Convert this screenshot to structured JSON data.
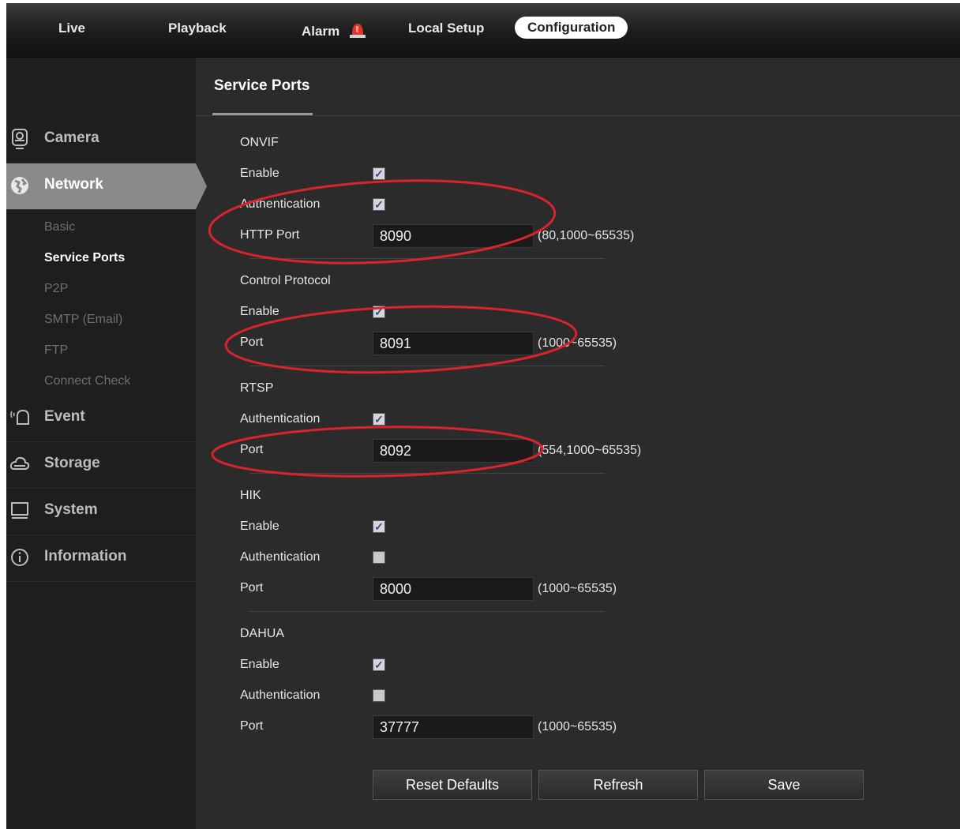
{
  "topnav": {
    "live": "Live",
    "playback": "Playback",
    "alarm": "Alarm",
    "local_setup": "Local Setup",
    "configuration": "Configuration"
  },
  "sidebar": {
    "camera": "Camera",
    "network": "Network",
    "network_items": [
      "Basic",
      "Service Ports",
      "P2P",
      "SMTP (Email)",
      "FTP",
      "Connect Check"
    ],
    "event": "Event",
    "storage": "Storage",
    "system": "System",
    "information": "Information"
  },
  "page_title": "Service Ports",
  "onvif": {
    "title": "ONVIF",
    "enable_label": "Enable",
    "enable": true,
    "auth_label": "Authentication",
    "auth": true,
    "port_label": "HTTP Port",
    "port": "8090",
    "range": "(80,1000~65535)"
  },
  "control": {
    "title": "Control Protocol",
    "enable_label": "Enable",
    "enable": true,
    "port_label": "Port",
    "port": "8091",
    "range": "(1000~65535)"
  },
  "rtsp": {
    "title": "RTSP",
    "auth_label": "Authentication",
    "auth": true,
    "port_label": "Port",
    "port": "8092",
    "range": "(554,1000~65535)"
  },
  "hik": {
    "title": "HIK",
    "enable_label": "Enable",
    "enable": true,
    "auth_label": "Authentication",
    "auth": false,
    "port_label": "Port",
    "port": "8000",
    "range": "(1000~65535)"
  },
  "dahua": {
    "title": "DAHUA",
    "enable_label": "Enable",
    "enable": true,
    "auth_label": "Authentication",
    "auth": false,
    "port_label": "Port",
    "port": "37777",
    "range": "(1000~65535)"
  },
  "buttons": {
    "reset": "Reset Defaults",
    "refresh": "Refresh",
    "save": "Save"
  },
  "colors": {
    "annotation": "#d9232e",
    "active_tab": "#ffffff",
    "sidebar_active": "#8a8a8a"
  }
}
